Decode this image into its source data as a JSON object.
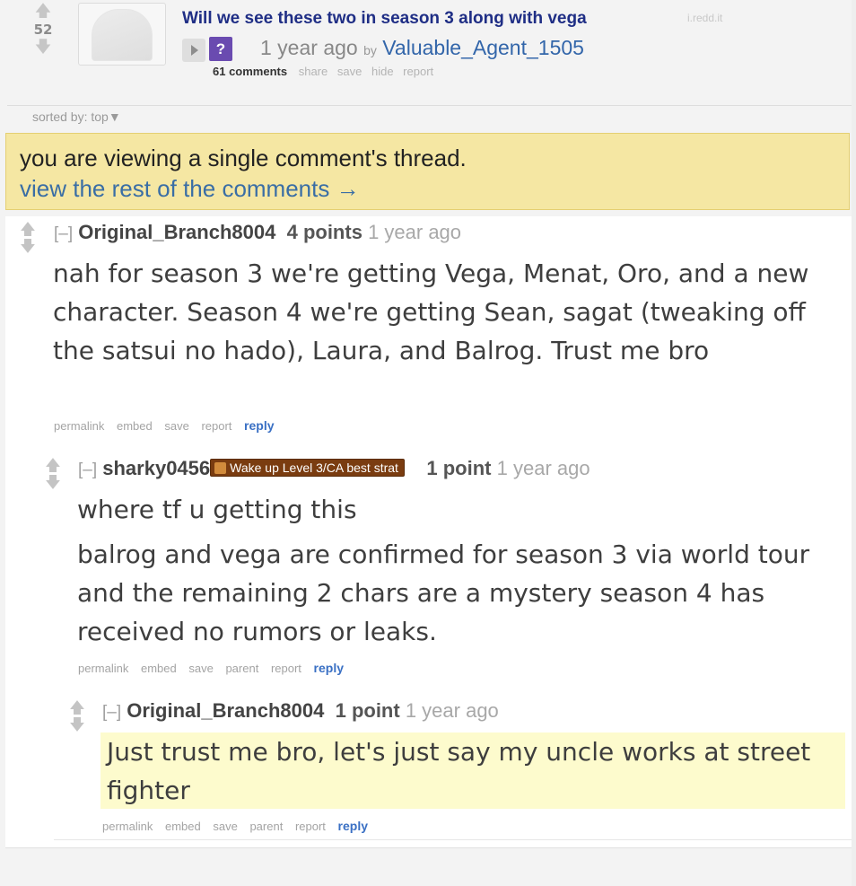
{
  "post": {
    "score": "52",
    "title": "Will we see these two in season 3 along with vega",
    "domain": "i.redd.it",
    "flair_glyph": "?",
    "age": "1 year ago",
    "by_label": "by",
    "author": "Valuable_Agent_1505",
    "buttons": {
      "comments": "61 comments",
      "share": "share",
      "save": "save",
      "hide": "hide",
      "report": "report"
    }
  },
  "sort": {
    "label": "sorted by: top▼"
  },
  "notice": {
    "text": "you are viewing a single comment's thread.",
    "link": "view the rest of the comments →"
  },
  "comments": [
    {
      "collapse": "[–]",
      "author": "Original_Branch8004",
      "points": "4 points",
      "age": "1 year ago",
      "body": [
        "nah for season 3 we're getting Vega, Menat, Oro, and a new character. Season 4 we're getting Sean, sagat (tweaking off the satsui no hado), Laura, and Balrog. Trust me bro"
      ],
      "buttons": [
        "permalink",
        "embed",
        "save",
        "report"
      ],
      "reply": "reply"
    },
    {
      "collapse": "[–]",
      "author": "sharky0456",
      "flair": "Wake up Level 3/CA best strat",
      "points": "1 point",
      "age": "1 year ago",
      "body": [
        "where tf u getting this",
        "balrog and vega are confirmed for season 3 via world tour and the remaining 2 chars are a mystery season 4 has received no rumors or leaks."
      ],
      "buttons": [
        "permalink",
        "embed",
        "save",
        "parent",
        "report"
      ],
      "reply": "reply"
    },
    {
      "collapse": "[–]",
      "author": "Original_Branch8004",
      "points": "1 point",
      "age": "1 year ago",
      "body": [
        "Just trust me bro, let's just say my uncle works at street fighter"
      ],
      "buttons": [
        "permalink",
        "embed",
        "save",
        "parent",
        "report"
      ],
      "reply": "reply"
    }
  ],
  "icons": {
    "upvote": "arrow-up-icon",
    "downvote": "arrow-down-icon",
    "expand": "play-triangle-icon"
  }
}
